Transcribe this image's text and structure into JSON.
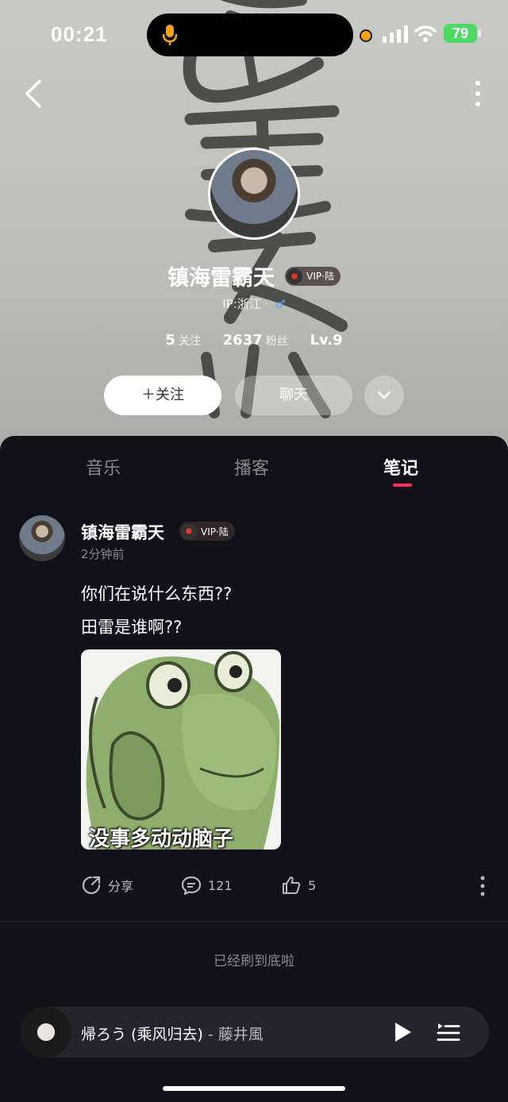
{
  "status_bar": {
    "time": "00:21",
    "battery": "79"
  },
  "profile": {
    "name": "镇海雷霸天",
    "vip_label": "VIP·陆",
    "ip_text": "IP:浙江 · ",
    "following_count": "5",
    "following_label": "关注",
    "followers_count": "2637",
    "followers_label": "粉丝",
    "level": "Lv.9"
  },
  "actions": {
    "follow_label": "＋关注",
    "chat_label": "聊天"
  },
  "tabs": [
    {
      "label": "音乐",
      "active": false
    },
    {
      "label": "播客",
      "active": false
    },
    {
      "label": "笔记",
      "active": true
    }
  ],
  "post": {
    "author": "镇海雷霸天",
    "vip_label": "VIP·陆",
    "time": "2分钟前",
    "lines": [
      "你们在说什么东西??",
      "田雷是谁啊??"
    ],
    "image_caption": "没事多动动脑子",
    "share_label": "分享",
    "comment_count": "121",
    "like_count": "5"
  },
  "footer": {
    "end_text": "已经刷到底啦"
  },
  "player": {
    "title": "帰ろう (乘风归去)",
    "artist": " - 藤井風"
  },
  "colors": {
    "accent": "#ff2d55",
    "panel": "#121019",
    "battery": "#4cd964"
  }
}
